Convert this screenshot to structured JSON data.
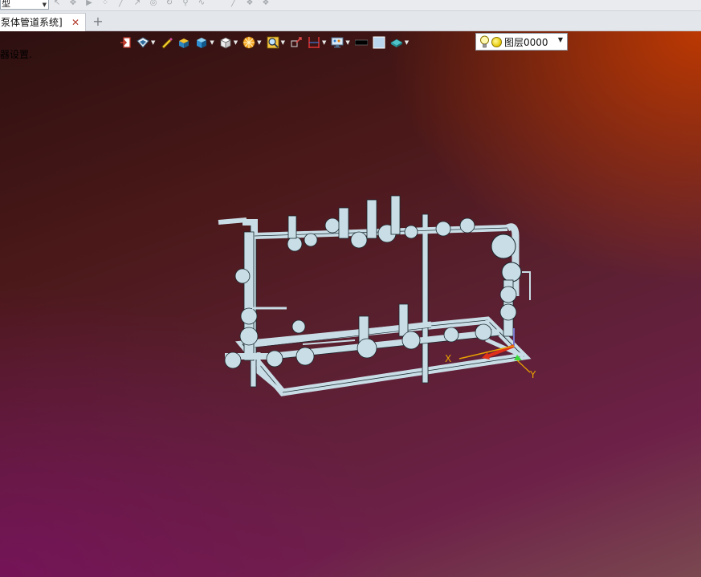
{
  "top_bar": {
    "mode_value": "模型",
    "mode_value_visible": "型"
  },
  "tabs": [
    {
      "label": "泵体管道系统]",
      "close_glyph": "✕"
    }
  ],
  "add_tab_glyph": "+",
  "status_text": "器设置.",
  "layer_selector": {
    "value": "图层0000"
  },
  "toolbar_icons": [
    "exit-view-icon",
    "view-orientation-icon",
    "sketch-pen-icon",
    "box-render-icon",
    "shaded-cube-icon",
    "wire-cube-icon",
    "section-gear-icon",
    "zoom-fit-icon",
    "coordinate-icon",
    "dimension-icon",
    "display-settings-icon",
    "black-swatch-icon",
    "light-swatch-icon",
    "material-icon",
    "lightbulb-icon",
    "layer-sun-icon"
  ],
  "colors": {
    "viewport_top_right": "#c83c00",
    "viewport_bottom_left": "#820a6e",
    "model_pipe": "#c9dde6",
    "model_outline": "#1a2a30",
    "axis_x": "#e0301a",
    "axis_y": "#e8a000",
    "axis_z": "#3ad83a"
  },
  "axis_labels": {
    "x": "X",
    "y": "Y"
  }
}
